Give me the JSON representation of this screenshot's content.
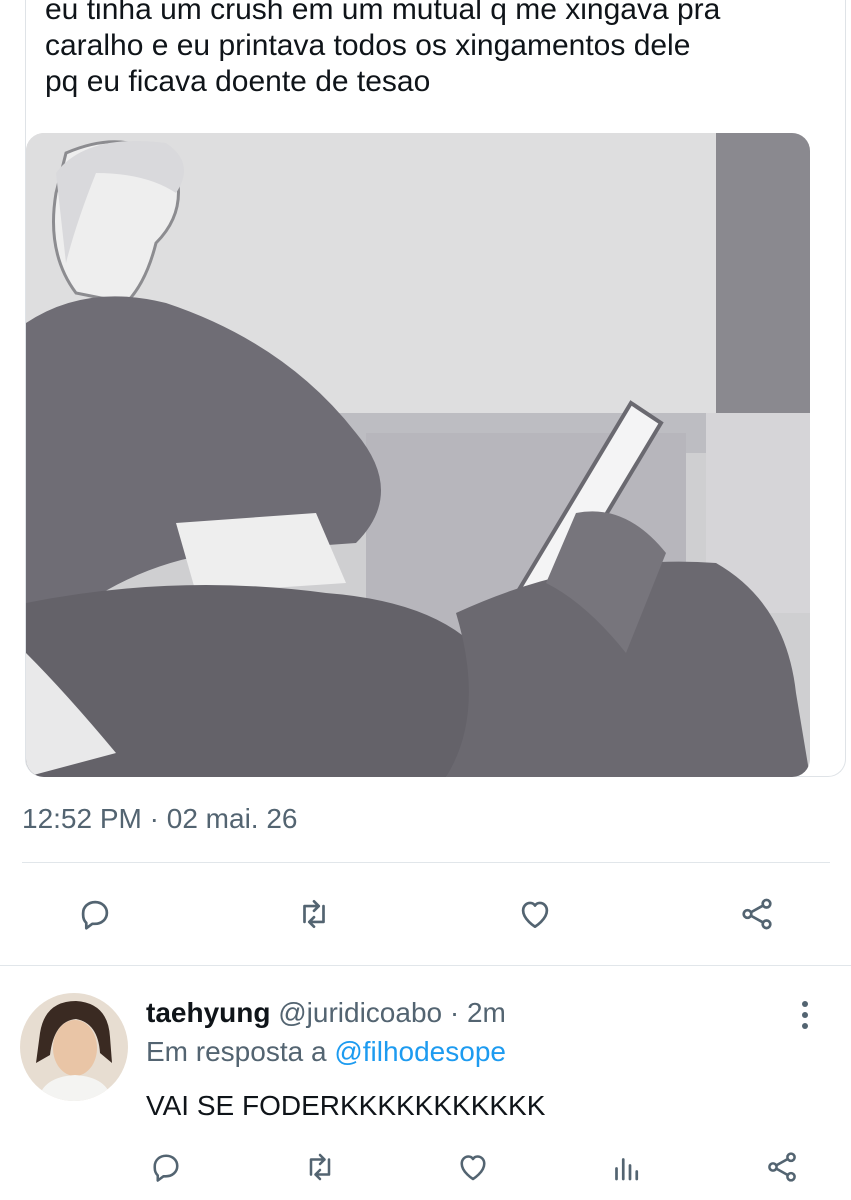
{
  "quoted_tweet": {
    "text_lines": [
      "eu tinha um crush em um mutual q me xingava pra",
      "caralho e eu printava todos os xingamentos dele",
      "pq eu ficava doente de tesao"
    ]
  },
  "tweet_meta": {
    "time": "12:52 PM",
    "separator": "·",
    "date": "02 mai. 26"
  },
  "main_actions": {
    "icons": [
      "reply-icon",
      "retweet-icon",
      "like-icon",
      "share-icon"
    ]
  },
  "reply": {
    "display_name": "taehyung",
    "handle": "@juridicoabo",
    "separator": "·",
    "time_ago": "2m",
    "replying_to_label": "Em resposta a",
    "replying_to_handle": "@filhodesope",
    "text": "VAI SE FODERKKKKKKKKKKK",
    "actions": [
      "reply-icon",
      "retweet-icon",
      "like-icon",
      "analytics-icon",
      "share-icon"
    ]
  },
  "colors": {
    "text": "#0f1419",
    "secondary": "#536471",
    "link": "#1d9bf0",
    "divider": "#e1e6ea"
  }
}
